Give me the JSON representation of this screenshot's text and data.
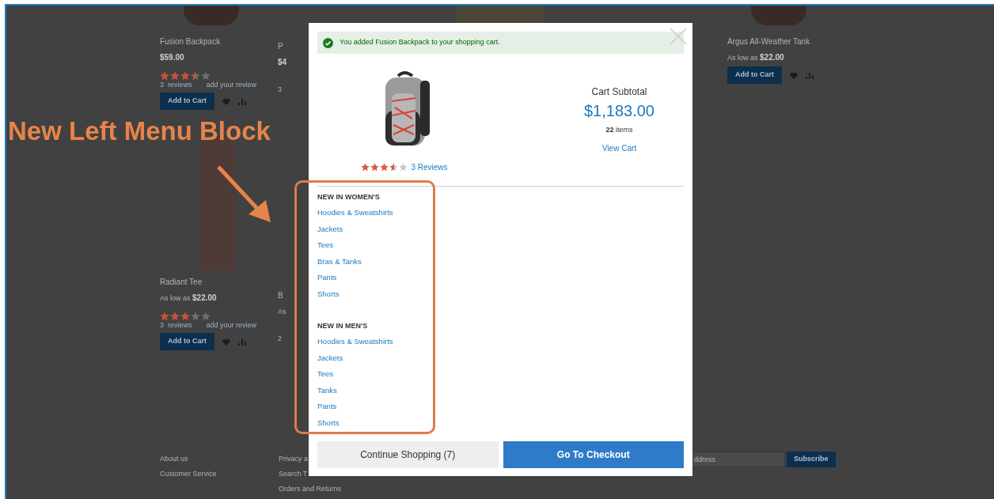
{
  "annotation": {
    "label": "New Left Menu Block"
  },
  "products": [
    {
      "name": "Fusion Backpack",
      "price": "$59.00",
      "stars": 3.5,
      "reviews": "3  reviews",
      "add_review": "add your review",
      "button": "Add to Cart"
    },
    {
      "name": "P",
      "price": "$4",
      "reviews": "3"
    },
    {
      "name": "Argus All-Weather Tank",
      "price_prefix": "As low as",
      "price": "$22.00",
      "button": "Add to Cart"
    },
    {
      "name": "Radiant Tee",
      "price_prefix": "As low as",
      "price": "$22.00",
      "stars": 3,
      "reviews": "3  reviews",
      "add_review": "add your review",
      "button": "Add to Cart"
    },
    {
      "name": "B",
      "price_prefix": "As",
      "reviews": "2"
    }
  ],
  "footer": {
    "columns": [
      [
        "About us",
        "Customer Service"
      ],
      [
        "Privacy a",
        "Search T",
        "Orders and Returns"
      ]
    ],
    "newsletter": {
      "value": "ddress",
      "button": "Subscribe"
    }
  },
  "modal": {
    "message": "You added Fusion Backpack to your shopping cart.",
    "product": {
      "stars": 3.5,
      "reviews_link": "3 Reviews"
    },
    "cart": {
      "label": "Cart Subtotal",
      "subtotal": "$1,183.00",
      "count": "22",
      "count_label": "items",
      "link": "View Cart"
    },
    "menu_sections": [
      {
        "title": "NEW IN WOMEN'S",
        "links": [
          "Hoodies & Sweatshirts",
          "Jackets",
          "Tees",
          "Bras & Tanks",
          "Pants",
          "Shorts"
        ]
      },
      {
        "title": "NEW IN MEN'S",
        "links": [
          "Hoodies & Sweatshirts",
          "Jackets",
          "Tees",
          "Tanks",
          "Pants",
          "Shorts"
        ]
      }
    ],
    "buttons": [
      {
        "label": "Continue Shopping (7)",
        "kind": "secondary"
      },
      {
        "label": "Go To Checkout",
        "kind": "primary"
      }
    ]
  }
}
